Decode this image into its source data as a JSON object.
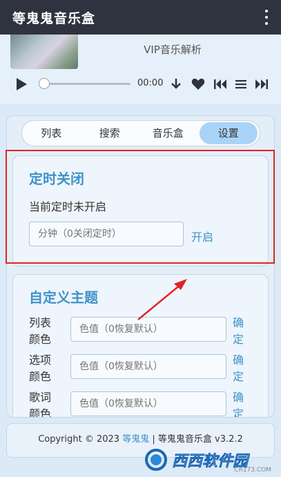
{
  "app": {
    "title": "等鬼鬼音乐盒"
  },
  "player": {
    "song_title": "VIP音乐解析",
    "time": "00:00",
    "progress": 0
  },
  "tabs": [
    {
      "label": "列表",
      "active": false
    },
    {
      "label": "搜索",
      "active": false
    },
    {
      "label": "音乐盒",
      "active": false
    },
    {
      "label": "设置",
      "active": true
    }
  ],
  "timer": {
    "title": "定时关闭",
    "status": "当前定时未开启",
    "input_placeholder": "分钟（0关闭定时）",
    "start_label": "开启"
  },
  "theme": {
    "title": "自定义主题",
    "rows": [
      {
        "label": "列表颜色",
        "placeholder": "色值（0恢复默认）",
        "confirm": "确定"
      },
      {
        "label": "选项颜色",
        "placeholder": "色值（0恢复默认）",
        "confirm": "确定"
      },
      {
        "label": "歌词颜色",
        "placeholder": "色值（0恢复默认）",
        "confirm": "确定"
      }
    ]
  },
  "footer": {
    "prefix": "Copyright © 2023 ",
    "brand": "等鬼鬼",
    "suffix": " | 等鬼鬼音乐盒 v3.2.2"
  },
  "watermark": {
    "text": "西西软件园",
    "sub": "CR173.COM"
  },
  "colors": {
    "accent": "#3e93c8",
    "appbar": "#2f3340",
    "highlight": "#e02424",
    "tab_active": "#a9d4f7"
  }
}
